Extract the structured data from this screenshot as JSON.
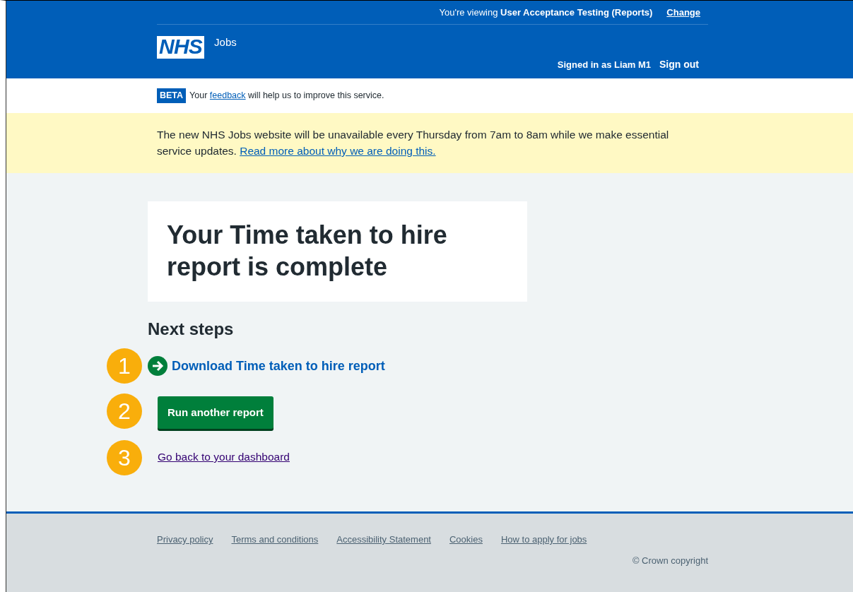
{
  "header": {
    "viewing_prefix": "You're viewing ",
    "viewing_org": "User Acceptance Testing (Reports)",
    "change_link": "Change",
    "logo": "NHS",
    "service_name": "Jobs",
    "signed_in": "Signed in as Liam M1",
    "sign_out": "Sign out"
  },
  "beta_banner": {
    "tag": "BETA",
    "link": "feedback",
    "before": "Your ",
    "after": " will help us to improve this service."
  },
  "notice": {
    "text": "The new NHS Jobs website will be unavailable every Thursday from 7am to 8am while we make essential service updates. ",
    "link": "Read more about why we are doing this."
  },
  "panel": {
    "title": "Your Time taken to hire report is complete"
  },
  "next_steps": {
    "heading": "Next steps",
    "items": [
      {
        "kind": "action_link",
        "callout": "1",
        "label": "Download Time taken to hire report"
      },
      {
        "kind": "button",
        "callout": "2",
        "label": "Run another report"
      },
      {
        "kind": "link",
        "callout": "3",
        "label": "Go back to your dashboard"
      }
    ]
  },
  "footer": {
    "links": [
      "Privacy policy",
      "Terms and conditions",
      "Accessibility Statement",
      "Cookies",
      "How to apply for jobs"
    ],
    "copyright": "© Crown copyright"
  }
}
